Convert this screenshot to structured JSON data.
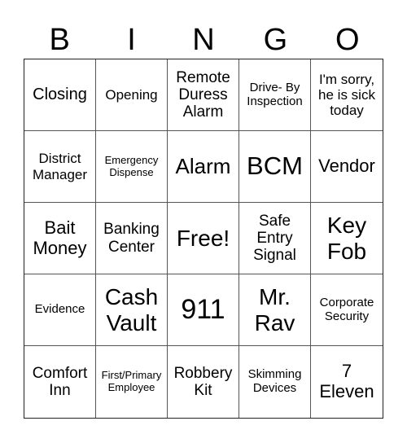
{
  "header": {
    "letters": [
      "B",
      "I",
      "N",
      "G",
      "O"
    ]
  },
  "board": {
    "rows": [
      [
        "Closing",
        "Opening",
        "Remote Duress Alarm",
        "Drive- By Inspection",
        "I'm sorry, he is sick today"
      ],
      [
        "District Manager",
        "Emergency Dispense",
        "Alarm",
        "BCM",
        "Vendor"
      ],
      [
        "Bait Money",
        "Banking Center",
        "Free!",
        "Safe Entry Signal",
        "Key Fob"
      ],
      [
        "Evidence",
        "Cash Vault",
        "911",
        "Mr. Rav",
        "Corporate Security"
      ],
      [
        "Comfort Inn",
        "First/Primary Employee",
        "Robbery Kit",
        "Skimming Devices",
        "7 Eleven"
      ]
    ]
  }
}
